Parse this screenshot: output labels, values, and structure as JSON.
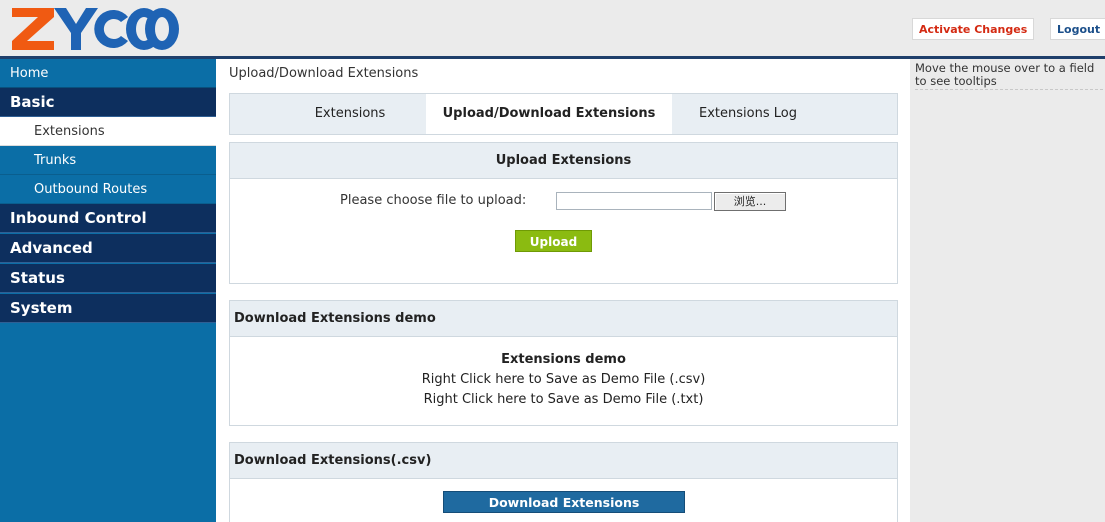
{
  "header": {
    "logo_text": "ZYCOO",
    "activate_label": "Activate Changes",
    "logout_label": "Logout"
  },
  "sidebar": {
    "home": "Home",
    "basic": "Basic",
    "basic_items": [
      "Extensions",
      "Trunks",
      "Outbound Routes"
    ],
    "sections": [
      "Inbound Control",
      "Advanced",
      "Status",
      "System"
    ]
  },
  "main": {
    "breadcrumb": "Upload/Download Extensions",
    "tabs": [
      "Extensions",
      "Upload/Download Extensions",
      "Extensions Log"
    ],
    "upload": {
      "title": "Upload Extensions",
      "label": "Please choose file to upload:",
      "browse_label": "浏览...",
      "file_value": "",
      "upload_button": "Upload"
    },
    "demo": {
      "title": "Download Extensions demo",
      "subtitle": "Extensions demo",
      "csv_link": "Right Click here to Save as Demo File (.csv)",
      "txt_link": "Right Click here to Save as Demo File (.txt)"
    },
    "download": {
      "title": "Download Extensions(.csv)",
      "button": "Download Extensions"
    }
  },
  "tooltip": {
    "text": "Move the mouse over to a field to see tooltips"
  },
  "colors": {
    "logo_orange": "#f05a12",
    "logo_blue": "#1f63b4",
    "nav_blue": "#0b6ea6",
    "nav_dark": "#0d2f5e",
    "upload_green": "#8bbb11",
    "activate_red": "#d42a12"
  }
}
